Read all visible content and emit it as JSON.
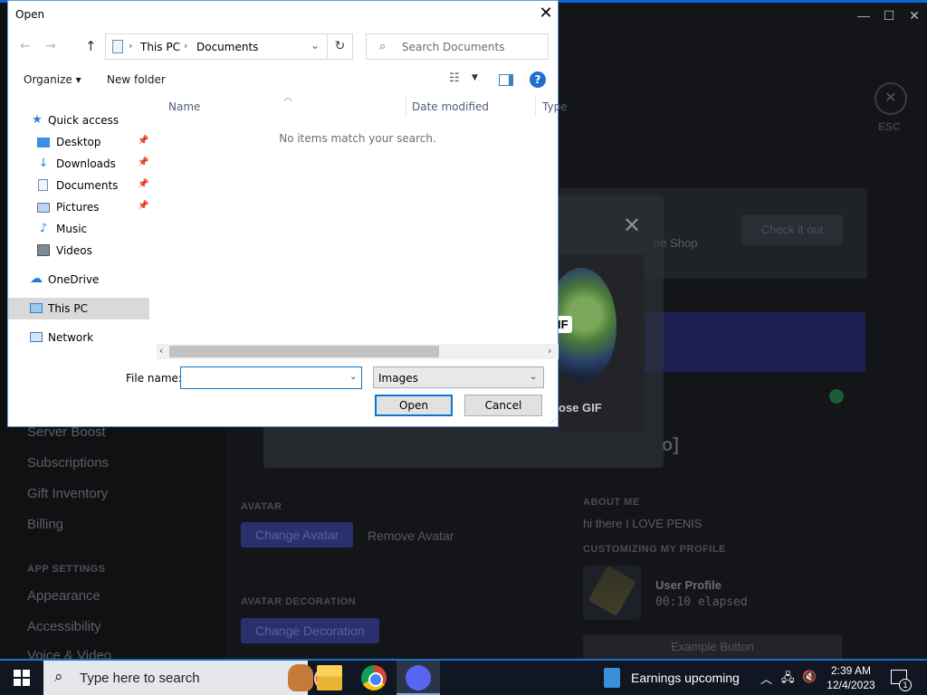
{
  "background_app": {
    "window_controls": [
      "—",
      "☐",
      "✕"
    ],
    "sidebar": {
      "items_top": [
        "Server Boost",
        "Subscriptions",
        "Gift Inventory",
        "Billing"
      ],
      "section_head": "APP SETTINGS",
      "items_bottom": [
        "Appearance",
        "Accessibility",
        "Voice & Video"
      ]
    },
    "esc_label": "ESC",
    "promo_text": "ne Shop",
    "promo_button": "Check it out",
    "choose_gif": "ose GIF",
    "gif_badge": "IF",
    "bracket_text": "o]",
    "avatar_section": "AVATAR",
    "change_avatar": "Change Avatar",
    "remove_avatar": "Remove Avatar",
    "avatar_decoration_section": "AVATAR DECORATION",
    "change_decoration": "Change Decoration",
    "about_me_label": "ABOUT ME",
    "about_me_text": "hi there I LOVE PENIS",
    "customizing_label": "CUSTOMIZING MY PROFILE",
    "user_profile": "User Profile",
    "elapsed": "00:10 elapsed",
    "example_button": "Example Button"
  },
  "dialog": {
    "title": "Open",
    "breadcrumb": [
      "This PC",
      "Documents"
    ],
    "search_placeholder": "Search Documents",
    "toolbar": {
      "organize": "Organize ▾",
      "new_folder": "New folder"
    },
    "nav": [
      {
        "label": "Quick access",
        "icon": "star-icon",
        "pinned": false
      },
      {
        "label": "Desktop",
        "icon": "desktop-icon",
        "pinned": true
      },
      {
        "label": "Downloads",
        "icon": "download-icon",
        "pinned": true
      },
      {
        "label": "Documents",
        "icon": "document-icon",
        "pinned": true
      },
      {
        "label": "Pictures",
        "icon": "pictures-icon",
        "pinned": true
      },
      {
        "label": "Music",
        "icon": "music-icon",
        "pinned": false
      },
      {
        "label": "Videos",
        "icon": "video-icon",
        "pinned": false
      },
      {
        "label": "OneDrive",
        "icon": "cloud-icon",
        "pinned": false
      },
      {
        "label": "This PC",
        "icon": "pc-icon",
        "pinned": false,
        "selected": true
      },
      {
        "label": "Network",
        "icon": "network-icon",
        "pinned": false
      }
    ],
    "columns": [
      "Name",
      "Date modified",
      "Type"
    ],
    "empty_message": "No items match your search.",
    "file_name_label": "File name:",
    "file_name_value": "",
    "filter_value": "Images",
    "open_button": "Open",
    "cancel_button": "Cancel"
  },
  "taskbar": {
    "search_placeholder": "Type here to search",
    "news": "Earnings upcoming",
    "time": "2:39 AM",
    "date": "12/4/2023",
    "notification_count": "1"
  }
}
